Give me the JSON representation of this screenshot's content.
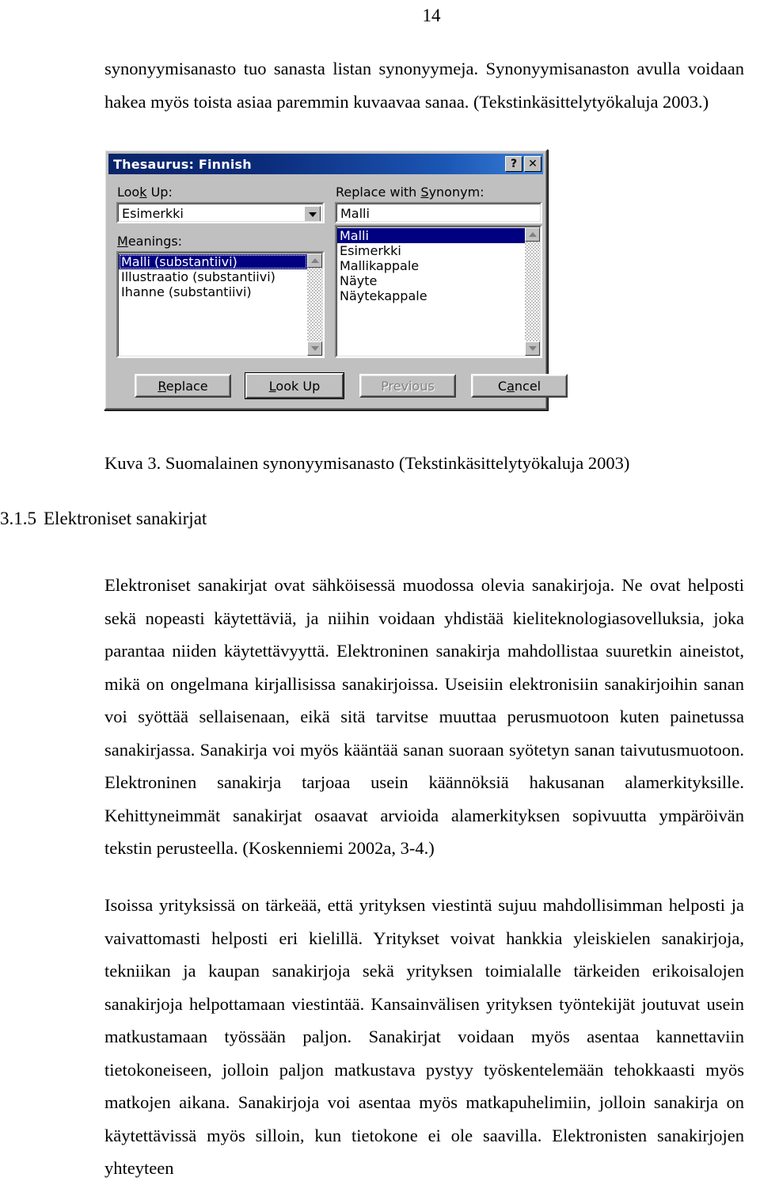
{
  "page": {
    "number": "14"
  },
  "paragraphs": {
    "intro": "synonyymisanasto tuo sanasta listan synonyymeja. Synonyymisanaston avulla voidaan hakea myös toista asiaa paremmin kuvaavaa sanaa. (Tekstinkäsittelytyökaluja 2003.)",
    "body1": "Elektroniset sanakirjat ovat sähköisessä muodossa olevia sanakirjoja. Ne ovat helposti sekä nopeasti käytettäviä, ja niihin voidaan yhdistää kieliteknologiasovelluksia, joka parantaa niiden käytettävyyttä. Elektroninen sanakirja mahdollistaa suuretkin aineistot, mikä on ongelmana kirjallisissa sanakirjoissa. Useisiin elektronisiin sanakirjoihin sanan voi syöttää sellaisenaan, eikä sitä tarvitse muuttaa perusmuotoon kuten painetussa sanakirjassa. Sanakirja voi myös kääntää sanan suoraan syötetyn sanan taivutusmuotoon. Elektroninen sanakirja tarjoaa usein käännöksiä hakusanan alamerkityksille. Kehittyneimmät sanakirjat osaavat arvioida alamerkityksen sopivuutta ympäröivän tekstin perusteella. (Koskenniemi 2002a, 3-4.)",
    "body2": "Isoissa yrityksissä on tärkeää, että yrityksen viestintä sujuu mahdollisimman helposti ja vaivattomasti helposti eri kielillä. Yritykset voivat hankkia yleiskielen sanakirjoja, tekniikan ja kaupan sanakirjoja sekä yrityksen toimialalle tärkeiden erikoisalojen sanakirjoja helpottamaan viestintää. Kansainvälisen yrityksen työntekijät joutuvat usein matkustamaan työssään paljon. Sanakirjat voidaan myös asentaa kannettaviin tietokoneiseen, jolloin paljon matkustava pystyy työskentelemään tehokkaasti myös matkojen aikana. Sanakirjoja voi asentaa myös matkapuhelimiin, jolloin sanakirja on käytettävissä myös silloin, kun tietokone ei ole saavilla. Elektronisten sanakirjojen yhteyteen"
  },
  "figure": {
    "caption": "Kuva 3. Suomalainen synonyymisanasto (Tekstinkäsittelytyökaluja 2003)"
  },
  "section": {
    "number": "3.1.5",
    "title": "Elektroniset sanakirjat"
  },
  "dialog": {
    "title": "Thesaurus: Finnish",
    "title_buttons": {
      "help": "?",
      "close": "✕"
    },
    "looked_up": {
      "label_pre": "Loo",
      "label_accel": "k",
      "label_post": " Up:",
      "value": "Esimerkki"
    },
    "meanings": {
      "label_accel": "M",
      "label_post": "eanings:",
      "items": [
        "Malli (substantiivi)",
        "Illustraatio (substantiivi)",
        "Ihanne (substantiivi)"
      ],
      "selected_index": 0
    },
    "replace_with": {
      "label_pre": "Replace with ",
      "label_accel": "S",
      "label_post": "ynonym:",
      "value": "Malli"
    },
    "synonyms": {
      "items": [
        "Malli",
        "Esimerkki",
        "Mallikappale",
        "Näyte",
        "Näytekappale"
      ],
      "selected_index": 0
    },
    "buttons": [
      {
        "pre": "",
        "accel": "R",
        "post": "eplace",
        "state": "normal"
      },
      {
        "pre": "",
        "accel": "L",
        "post": "ook Up",
        "state": "default"
      },
      {
        "pre": "Previous",
        "accel": "",
        "post": "",
        "state": "disabled"
      },
      {
        "pre": "C",
        "accel": "a",
        "post": "ncel",
        "state": "normal"
      }
    ],
    "colors": {
      "face": "#c0c0c0",
      "title_active": "#0a246a",
      "selection": "#000080",
      "selection_text": "#ffffff"
    }
  }
}
